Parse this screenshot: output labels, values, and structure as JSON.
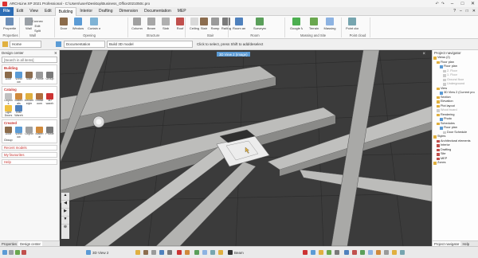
{
  "app": {
    "title": "ARCHLine.XP 2021  Professional  -  C:\\Users\\user\\Desktop\\Business_Office2021050c.pro",
    "window_controls": [
      "–",
      "□",
      "✕"
    ]
  },
  "menu": {
    "items": [
      "File",
      "Edit",
      "View",
      "Edit",
      "Building",
      "Interior",
      "Drafting",
      "Dimension",
      "Documentation",
      "MEP"
    ],
    "active": "Building",
    "right_items": [
      "?",
      "–",
      "□",
      "✕"
    ]
  },
  "ribbon": {
    "buttons": [
      {
        "label": "Properties",
        "color": "#6d8fb8"
      },
      {
        "label": "Wall",
        "color": "#9aa0a6"
      },
      {
        "label": "Door",
        "color": "#8b6b4a"
      },
      {
        "label": "Window",
        "color": "#5b9bd5"
      },
      {
        "label": "Curtain wall",
        "color": "#7fb3d5"
      },
      {
        "label": "Column",
        "color": "#a0a0a0"
      },
      {
        "label": "Beam",
        "color": "#a7a7a7"
      },
      {
        "label": "Slab",
        "color": "#b0b0b0"
      },
      {
        "label": "Roof",
        "color": "#c0504d"
      },
      {
        "label": "Ceiling",
        "color": "#d9d9d9"
      },
      {
        "label": "Stair",
        "color": "#8c6d4f"
      },
      {
        "label": "Ramp",
        "color": "#9a9a9a"
      },
      {
        "label": "Railing",
        "color": "#7a7a7a"
      },
      {
        "label": "Room and area",
        "color": "#4f81bd"
      },
      {
        "label": "Surveyed room",
        "color": "#5a9f5a"
      },
      {
        "label": "Google Maps",
        "color": "#4caf50"
      },
      {
        "label": "Terrain",
        "color": "#6aa84f"
      },
      {
        "label": "Massing",
        "color": "#8db3e2"
      },
      {
        "label": "Point cloud",
        "color": "#76a5af"
      }
    ],
    "small_buttons": [
      "Connection",
      "Edit",
      "Split"
    ],
    "groups": [
      "Properties",
      "Wall",
      "Opening",
      "Structure",
      "Stair",
      "Room",
      "Massing and Site",
      "Point cloud"
    ]
  },
  "toolbar2": {
    "layer_value": "Home",
    "doc_value": "Documentation",
    "model_value": "Build 3D model"
  },
  "hint": "Click to select, press Shift to add/deselect",
  "left_panel": {
    "title": "Design center",
    "search_placeholder": "[Search in all items]",
    "building": {
      "title": "Building",
      "items": [
        {
          "label": "Door",
          "color": "#8b6b4a"
        },
        {
          "label": "Wind ow",
          "color": "#5b9bd5"
        },
        {
          "label": "Stair",
          "color": "#8c6d4f"
        },
        {
          "label": "Profile",
          "color": "#9a9a9a"
        },
        {
          "label": "Group",
          "color": "#7a7a7a"
        }
      ]
    },
    "catalog": {
      "title": "Catalog",
      "items": [
        {
          "label": "Object s",
          "color": "#c0c0c0"
        },
        {
          "label": "Materi als",
          "color": "#d08a3c"
        },
        {
          "label": "Render style",
          "color": "#e0b040"
        },
        {
          "label": "Showr oom",
          "color": "#b07040"
        },
        {
          "label": "3D wareh",
          "color": "#cc3333"
        },
        {
          "label": "Light Doors",
          "color": "#f0c040"
        },
        {
          "label": "BIM Wareh",
          "color": "#4f81bd"
        }
      ]
    },
    "created": {
      "title": "Created",
      "items": [
        {
          "label": "Door",
          "color": "#8b6b4a"
        },
        {
          "label": "Wind ow",
          "color": "#5b9bd5"
        },
        {
          "label": "Object",
          "color": "#a0a0a0"
        },
        {
          "label": "Materi al",
          "color": "#d08a3c"
        },
        {
          "label": "Profile",
          "color": "#7a7a7a"
        }
      ],
      "group_label": "Group"
    },
    "links": [
      "Recent models",
      "My favourites",
      "Help"
    ],
    "tabs": [
      "Properties",
      "Design center"
    ]
  },
  "viewport": {
    "tab_label": "3D View 2 (Image)"
  },
  "right_panel": {
    "title": "Project navigator",
    "tree": [
      {
        "label": "Views (2)",
        "indent": 0,
        "gray": false,
        "color": "#e0b040"
      },
      {
        "label": "Floor plan",
        "indent": 1,
        "gray": false,
        "color": "#e0b040"
      },
      {
        "label": "Floor plan",
        "indent": 2,
        "gray": false,
        "color": "#5b9bd5"
      },
      {
        "label": "2. Floor",
        "indent": 3,
        "gray": true,
        "color": "#cccccc"
      },
      {
        "label": "1. Floor",
        "indent": 3,
        "gray": true,
        "color": "#cccccc"
      },
      {
        "label": "Ground floor",
        "indent": 3,
        "gray": true,
        "color": "#cccccc"
      },
      {
        "label": "Underground",
        "indent": 3,
        "gray": true,
        "color": "#cccccc"
      },
      {
        "label": "View",
        "indent": 1,
        "gray": false,
        "color": "#e0b040"
      },
      {
        "label": "3D View 2 (Current pro",
        "indent": 2,
        "gray": false,
        "color": "#5b9bd5"
      },
      {
        "label": "Section",
        "indent": 1,
        "gray": false,
        "color": "#e0b040"
      },
      {
        "label": "Elevation",
        "indent": 1,
        "gray": false,
        "color": "#e0b040"
      },
      {
        "label": "Plot layout",
        "indent": 1,
        "gray": false,
        "color": "#e0b040"
      },
      {
        "label": "Wood board",
        "indent": 1,
        "gray": true,
        "color": "#cccccc"
      },
      {
        "label": "Rendering",
        "indent": 1,
        "gray": false,
        "color": "#e0b040"
      },
      {
        "label": "Photo",
        "indent": 2,
        "gray": false,
        "color": "#5b9bd5"
      },
      {
        "label": "Schedules",
        "indent": 1,
        "gray": false,
        "color": "#e0b040"
      },
      {
        "label": "Floor plan",
        "indent": 2,
        "gray": false,
        "color": "#5b9bd5"
      },
      {
        "label": "Door Schedule",
        "indent": 3,
        "gray": false,
        "color": "#cccccc"
      },
      {
        "label": "Styles",
        "indent": 0,
        "gray": false,
        "color": "#e0b040"
      },
      {
        "label": "Architectural elements",
        "indent": 1,
        "gray": false,
        "color": "#c0504d"
      },
      {
        "label": "Interior",
        "indent": 1,
        "gray": false,
        "color": "#c0504d"
      },
      {
        "label": "Drafting",
        "indent": 1,
        "gray": false,
        "color": "#c0504d"
      },
      {
        "label": "Site",
        "indent": 1,
        "gray": false,
        "color": "#c0504d"
      },
      {
        "label": "MEP",
        "indent": 1,
        "gray": false,
        "color": "#c0504d"
      },
      {
        "label": "Zones",
        "indent": 0,
        "gray": false,
        "color": "#e0b040"
      }
    ],
    "tabs": [
      "Project navigator",
      "Help"
    ]
  },
  "status": {
    "view_label": "3D View 2",
    "layer_label": "Beam"
  }
}
